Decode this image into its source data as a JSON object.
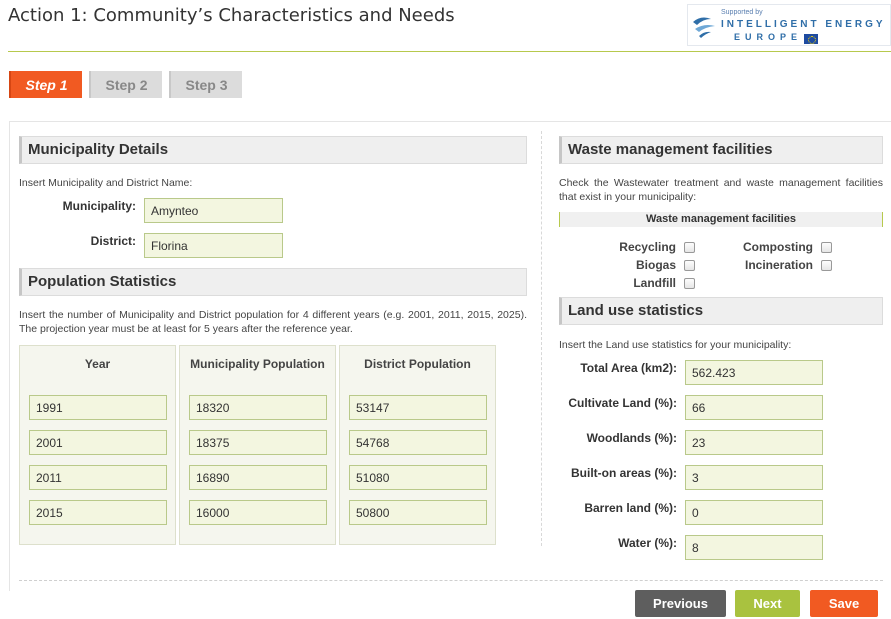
{
  "header": {
    "title": "Action 1: Community’s Characteristics and Needs",
    "logo": {
      "supported_by": "Supported by",
      "line1": "INTELLIGENT ENERGY",
      "line2": "EUROPE",
      "icon": "intelligent-energy-europe-logo"
    }
  },
  "steps": [
    {
      "label": "Step 1",
      "active": true
    },
    {
      "label": "Step 2",
      "active": false
    },
    {
      "label": "Step 3",
      "active": false
    }
  ],
  "municipality_details": {
    "title": "Municipality Details",
    "hint": "Insert Municipality and District Name:",
    "municipality_label": "Municipality:",
    "municipality_value": "Amynteo",
    "district_label": "District:",
    "district_value": "Florina"
  },
  "population_statistics": {
    "title": "Population Statistics",
    "hint": "Insert the number of Municipality and District population for 4 different years (e.g. 2001, 2011, 2015, 2025). The projection year must be at least for 5 years after the reference year.",
    "columns": [
      "Year",
      "Municipality Population",
      "District Population"
    ],
    "rows": [
      {
        "year": "1991",
        "municipality": "18320",
        "district": "53147"
      },
      {
        "year": "2001",
        "municipality": "18375",
        "district": "54768"
      },
      {
        "year": "2011",
        "municipality": "16890",
        "district": "51080"
      },
      {
        "year": "2015",
        "municipality": "16000",
        "district": "50800"
      }
    ]
  },
  "waste_management": {
    "title": "Waste management facilities",
    "hint": "Check the Wastewater treatment and waste management facilities that exist in your municipality:",
    "bar_label": "Waste management facilities",
    "options": [
      {
        "label": "Recycling",
        "checked": false
      },
      {
        "label": "Composting",
        "checked": false
      },
      {
        "label": "Biogas",
        "checked": false
      },
      {
        "label": "Incineration",
        "checked": false
      },
      {
        "label": "Landfill",
        "checked": false
      }
    ]
  },
  "land_use": {
    "title": "Land use statistics",
    "hint": "Insert the Land use statistics for your municipality:",
    "fields": [
      {
        "label": "Total Area (km2):",
        "value": "562.423"
      },
      {
        "label": "Cultivate Land (%):",
        "value": "66"
      },
      {
        "label": "Woodlands (%):",
        "value": "23"
      },
      {
        "label": "Built-on areas (%):",
        "value": "3"
      },
      {
        "label": "Barren land (%):",
        "value": "0"
      },
      {
        "label": "Water (%):",
        "value": "8"
      }
    ]
  },
  "footer": {
    "previous_label": "Previous",
    "next_label": "Next",
    "save_label": "Save"
  },
  "colors": {
    "accent_orange": "#f15a22",
    "accent_green": "#a9c23f",
    "button_gray": "#5e5e5e",
    "input_bg": "#f3f6e0"
  }
}
